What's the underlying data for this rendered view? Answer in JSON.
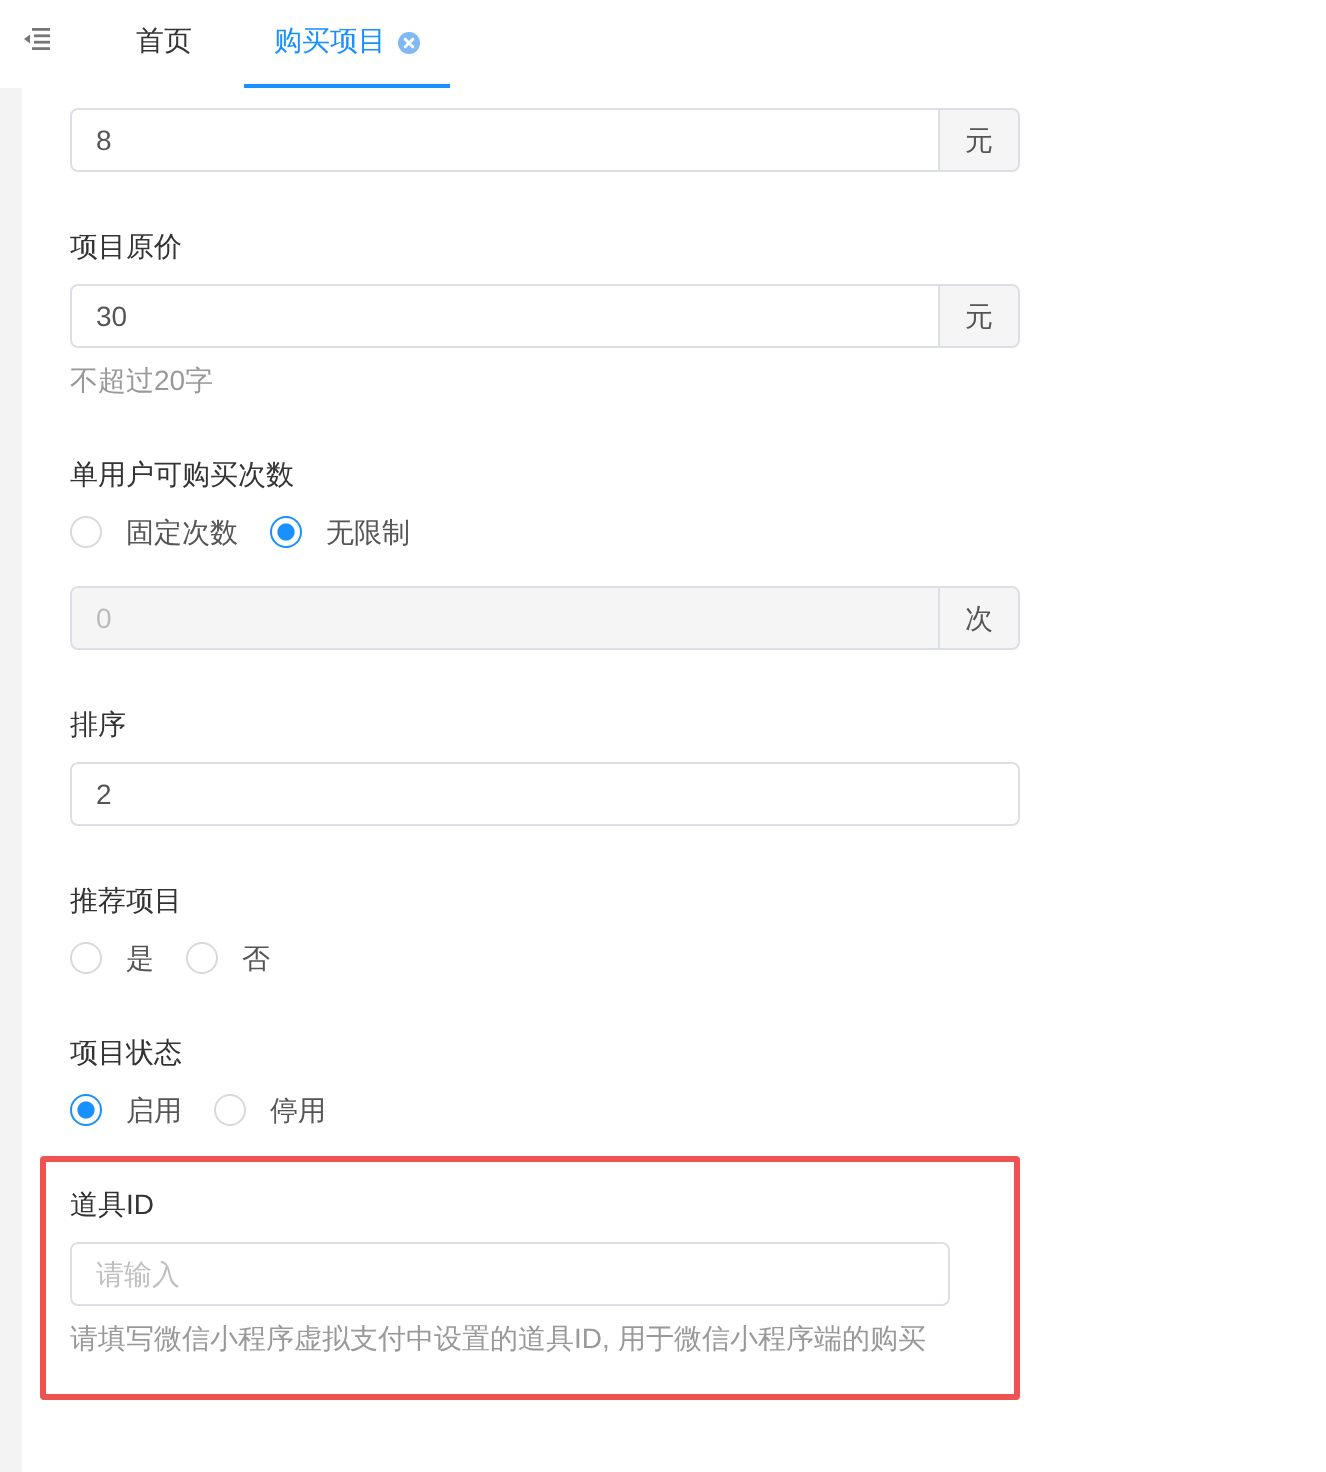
{
  "tabs": [
    {
      "label": "首页",
      "selected": false,
      "closable": false
    },
    {
      "label": "购买项目",
      "selected": true,
      "closable": true
    }
  ],
  "form": {
    "fields": [
      {
        "kind": "input",
        "value": "8",
        "suffix": "元",
        "disabled": false,
        "highlighted": false
      },
      {
        "kind": "input",
        "label": "项目原价",
        "value": "30",
        "suffix": "元",
        "disabled": false,
        "hint": "不超过20字",
        "highlighted": false
      },
      {
        "kind": "radio",
        "label": "单用户可购买次数",
        "options": [
          {
            "label": "固定次数",
            "selected": false
          },
          {
            "label": "无限制",
            "selected": true
          }
        ],
        "input": {
          "value": "0",
          "suffix": "次",
          "disabled": true
        },
        "highlighted": false
      },
      {
        "kind": "input",
        "label": "排序",
        "value": "2",
        "disabled": false,
        "highlighted": false
      },
      {
        "kind": "radio",
        "label": "推荐项目",
        "options": [
          {
            "label": "是",
            "selected": false
          },
          {
            "label": "否",
            "selected": false
          }
        ],
        "highlighted": false
      },
      {
        "kind": "radio",
        "label": "项目状态",
        "options": [
          {
            "label": "启用",
            "selected": true
          },
          {
            "label": "停用",
            "selected": false
          }
        ],
        "highlighted": false
      },
      {
        "kind": "input",
        "label": "道具ID",
        "placeholder": "请输入",
        "disabled": false,
        "hint": "请填写微信小程序虚拟支付中设置的道具ID, 用于微信小程序端的购买",
        "highlighted": true
      }
    ]
  }
}
